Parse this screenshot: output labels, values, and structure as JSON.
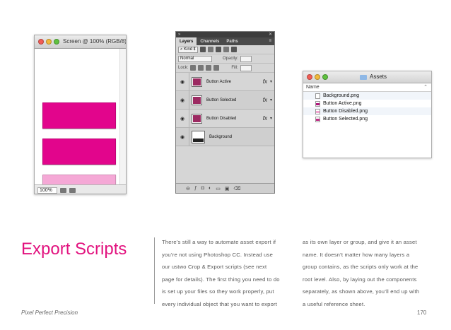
{
  "screen_window": {
    "title": "Screen @ 100% (RGB/8)",
    "zoom": "100%",
    "swatch_colors": [
      "#e2058c",
      "#e2058c",
      "#f5a8d6"
    ]
  },
  "layers_panel": {
    "tabs": [
      "Layers",
      "Channels",
      "Paths"
    ],
    "kind_label": "Kind",
    "blend_mode": "Normal",
    "opacity_label": "Opacity:",
    "lock_label": "Lock:",
    "fill_label": "Fill:",
    "fx_label": "fx",
    "layers": [
      "Button Active",
      "Button Selected",
      "Button Disabled",
      "Background"
    ]
  },
  "finder_window": {
    "title": "Assets",
    "column_header": "Name",
    "files": [
      "Background.png",
      "Button Active.png",
      "Button Disabled.png",
      "Button Selected.png"
    ]
  },
  "article": {
    "headline": "Export Scripts",
    "col1_lines": [
      "There’s still a way to automate asset export if",
      "you’re not using Photoshop CC. Instead use",
      "our ustwo Crop & Export scripts (see next",
      "page for details). The first thing you need to do",
      "is set up your files so they work properly, put",
      "every individual object that you want to export"
    ],
    "col2_lines": [
      "as its own layer or group, and give it an asset",
      "name. It doesn’t matter how many layers a",
      "group contains, as the scripts only work at the",
      "root level. Also, by laying out the components",
      "separately, as shown above, you’ll end up with",
      "a useful reference sheet."
    ]
  },
  "footer": {
    "left": "Pixel Perfect Precision",
    "page_number": "170"
  },
  "colors": {
    "accent": "#e2137f"
  }
}
